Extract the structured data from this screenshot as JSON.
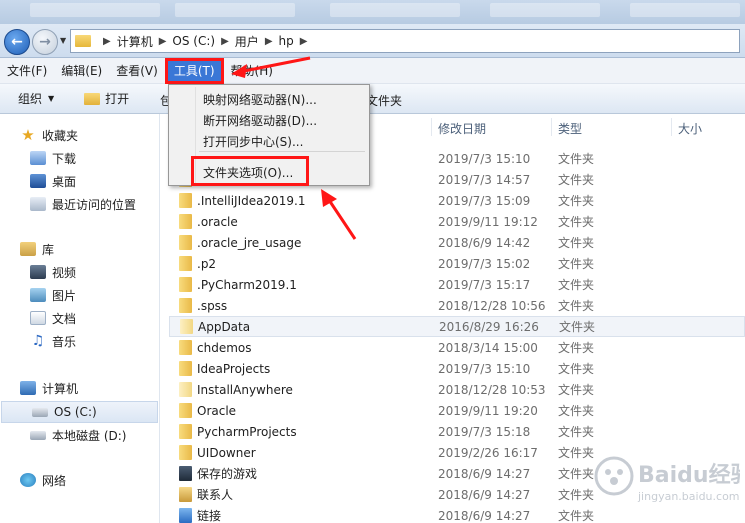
{
  "address": {
    "crumbs": [
      "计算机",
      "OS (C:)",
      "用户",
      "hp"
    ]
  },
  "menu": {
    "items": [
      "文件(F)",
      "编辑(E)",
      "查看(V)",
      "工具(T)",
      "帮助(H)"
    ]
  },
  "toolbar": {
    "organize": "组织",
    "open": "打开",
    "partial_left": "包",
    "partial_right": "文件夹"
  },
  "dropdown": {
    "items": [
      "映射网络驱动器(N)...",
      "断开网络驱动器(D)...",
      "打开同步中心(S)...",
      "文件夹选项(O)..."
    ]
  },
  "nav": {
    "favorites": "收藏夹",
    "download": "下载",
    "desktop": "桌面",
    "recent": "最近访问的位置",
    "libraries": "库",
    "video": "视频",
    "pictures": "图片",
    "documents": "文档",
    "music": "音乐",
    "computer": "计算机",
    "os_c": "OS (C:)",
    "local_d": "本地磁盘 (D:)",
    "network": "网络"
  },
  "columns": {
    "modified": "修改日期",
    "type": "类型",
    "size": "大小"
  },
  "files": [
    {
      "name": "",
      "date": "2019/7/3 15:10",
      "type": "文件夹"
    },
    {
      "name": "",
      "date": "2019/7/3 14:57",
      "type": "文件夹"
    },
    {
      "name": ".IntelliJIdea2019.1",
      "date": "2019/7/3 15:09",
      "type": "文件夹"
    },
    {
      "name": ".oracle",
      "date": "2019/9/11 19:12",
      "type": "文件夹"
    },
    {
      "name": ".oracle_jre_usage",
      "date": "2018/6/9 14:42",
      "type": "文件夹"
    },
    {
      "name": ".p2",
      "date": "2019/7/3 15:02",
      "type": "文件夹"
    },
    {
      "name": ".PyCharm2019.1",
      "date": "2019/7/3 15:17",
      "type": "文件夹"
    },
    {
      "name": ".spss",
      "date": "2018/12/28 10:56",
      "type": "文件夹"
    },
    {
      "name": "AppData",
      "date": "2016/8/29 16:26",
      "type": "文件夹"
    },
    {
      "name": "chdemos",
      "date": "2018/3/14 15:00",
      "type": "文件夹"
    },
    {
      "name": "IdeaProjects",
      "date": "2019/7/3 15:10",
      "type": "文件夹"
    },
    {
      "name": "InstallAnywhere",
      "date": "2018/12/28 10:53",
      "type": "文件夹"
    },
    {
      "name": "Oracle",
      "date": "2019/9/11 19:20",
      "type": "文件夹"
    },
    {
      "name": "PycharmProjects",
      "date": "2019/7/3 15:18",
      "type": "文件夹"
    },
    {
      "name": "UIDowner",
      "date": "2019/2/26 16:17",
      "type": "文件夹"
    },
    {
      "name": "保存的游戏",
      "date": "2018/6/9 14:27",
      "type": "文件夹"
    },
    {
      "name": "联系人",
      "date": "2018/6/9 14:27",
      "type": "文件夹"
    },
    {
      "name": "链接",
      "date": "2018/6/9 14:27",
      "type": "文件夹"
    }
  ],
  "watermark": {
    "text": "Baidu经验",
    "url": "jingyan.baidu.com"
  },
  "colors": {
    "accent_red": "#ff1616",
    "menu_active": "#3a77d6"
  }
}
